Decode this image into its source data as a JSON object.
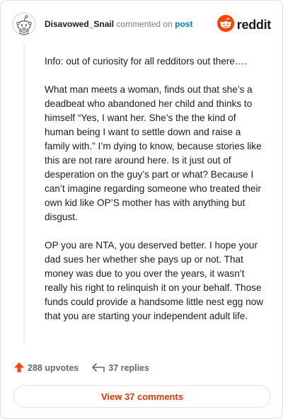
{
  "header": {
    "author": "Disavowed_Snail",
    "commented_text": "commented on",
    "post_link": "post",
    "logo_text": "reddit"
  },
  "comment": {
    "paragraphs": [
      "Info: out of curiosity for all redditors out there….",
      "What man meets a woman, finds out that she’s a deadbeat who abandoned her child and thinks to himself “Yes, I want her. She’s the the kind of human being I want to settle down and raise a family with.” I’m dying to know, because stories like this are not rare around here. Is it just out of desperation on the guy’s part or what? Because I can’t imagine regarding someone who treated their own kid like OP’S mother has with anything but disgust.",
      "OP you are NTA, you deserved better. I hope your dad sues her whether she pays up or not. That money was due to you over the years, it wasn’t really his right to relinquish it on your behalf. Those funds could provide a handsome little nest egg now that you are starting your independent adult life."
    ]
  },
  "actions": {
    "upvotes": "288 upvotes",
    "replies": "37 replies"
  },
  "footer": {
    "view_comments": "View 37 comments"
  },
  "colors": {
    "brand": "#ff4500",
    "link": "#0079d3",
    "view_button_text": "#d93a00"
  },
  "icons": [
    "snoo-avatar-icon",
    "reddit-logo-icon",
    "upvote-arrow-icon",
    "reply-icon"
  ]
}
